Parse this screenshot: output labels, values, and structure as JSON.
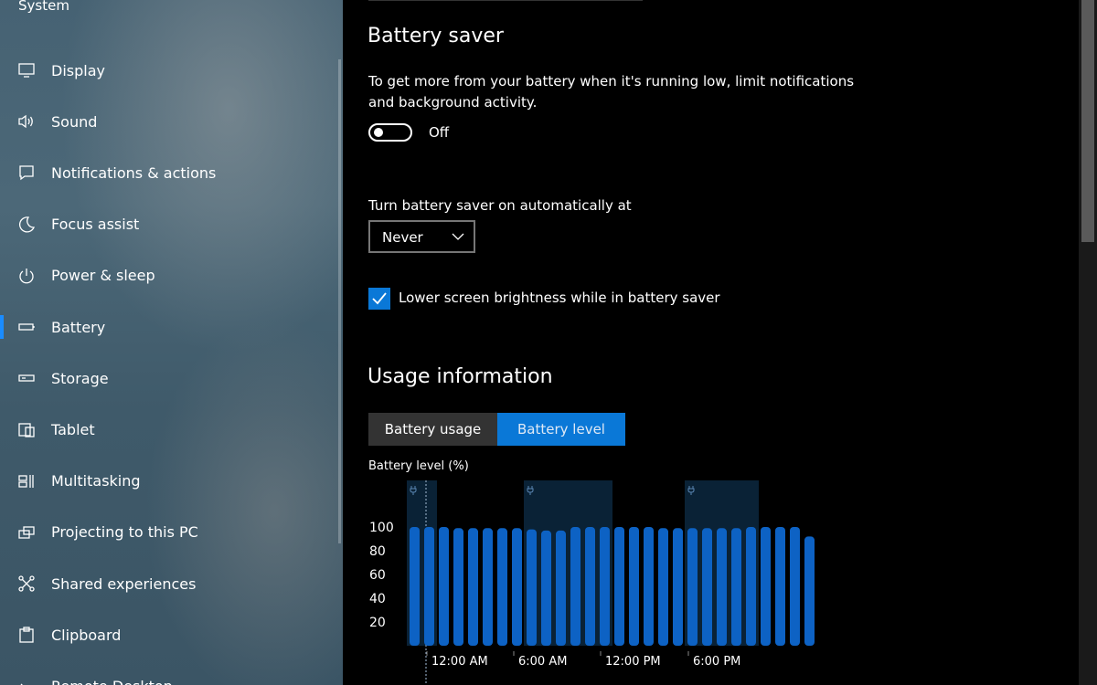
{
  "sidebar": {
    "section_title": "System",
    "selected_index": 5,
    "items": [
      {
        "label": "Display",
        "icon": "display-icon"
      },
      {
        "label": "Sound",
        "icon": "speaker-icon"
      },
      {
        "label": "Notifications & actions",
        "icon": "notification-icon"
      },
      {
        "label": "Focus assist",
        "icon": "moon-icon"
      },
      {
        "label": "Power & sleep",
        "icon": "power-icon"
      },
      {
        "label": "Battery",
        "icon": "battery-icon"
      },
      {
        "label": "Storage",
        "icon": "storage-icon"
      },
      {
        "label": "Tablet",
        "icon": "tablet-icon"
      },
      {
        "label": "Multitasking",
        "icon": "multitasking-icon"
      },
      {
        "label": "Projecting to this PC",
        "icon": "projecting-icon"
      },
      {
        "label": "Shared experiences",
        "icon": "shared-icon"
      },
      {
        "label": "Clipboard",
        "icon": "clipboard-icon"
      },
      {
        "label": "Remote Desktop",
        "icon": "remote-desktop-icon"
      }
    ]
  },
  "battery_saver": {
    "title": "Battery saver",
    "description_line1": "To get more from your battery when it's running low, limit notifications",
    "description_line2": "and background activity.",
    "toggle_state": "Off",
    "auto_label": "Turn battery saver on automatically at",
    "auto_value": "Never",
    "brightness_label": "Lower screen brightness while in battery saver",
    "brightness_checked": true
  },
  "usage": {
    "title": "Usage information",
    "tabs": [
      "Battery usage",
      "Battery level"
    ],
    "active_tab": "Battery level"
  },
  "colors": {
    "accent": "#0a78d7",
    "bar": "#0d62c4",
    "charging_band": "#0a2236"
  },
  "chart_data": {
    "type": "bar",
    "ylabel": "Battery level (%)",
    "yticks": [
      100,
      80,
      60,
      40,
      20
    ],
    "ylim": [
      0,
      100
    ],
    "x_tick_labels": [
      "12:00 AM",
      "6:00 AM",
      "12:00 PM",
      "6:00 PM"
    ],
    "values": [
      100,
      100,
      100,
      99,
      99,
      99,
      99,
      99,
      98,
      97,
      97,
      100,
      100,
      100,
      100,
      100,
      100,
      99,
      99,
      99,
      99,
      99,
      99,
      100,
      100,
      100,
      100,
      92
    ],
    "charging_periods_bar_index": [
      [
        0,
        1
      ],
      [
        8,
        13
      ],
      [
        19,
        23
      ]
    ]
  }
}
